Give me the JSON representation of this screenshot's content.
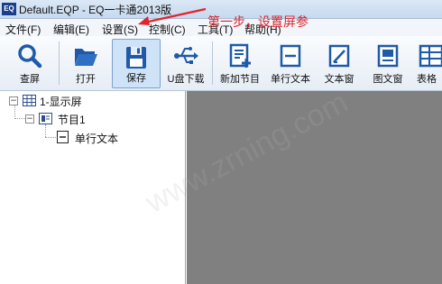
{
  "window": {
    "app_icon_text": "EQ",
    "title": "Default.EQP - EQ一卡通2013版"
  },
  "menu": [
    {
      "label": "文件(F)"
    },
    {
      "label": "编辑(E)"
    },
    {
      "label": "设置(S)"
    },
    {
      "label": "控制(C)"
    },
    {
      "label": "工具(T)"
    },
    {
      "label": "帮助(H)"
    }
  ],
  "toolbar": [
    {
      "label": "查屏",
      "icon": "magnifier-icon"
    },
    {
      "label": "打开",
      "icon": "folder-open-icon"
    },
    {
      "label": "保存",
      "icon": "save-disk-icon"
    },
    {
      "label": "U盘下载",
      "icon": "usb-icon"
    },
    {
      "label": "新加节目",
      "icon": "new-program-icon"
    },
    {
      "label": "单行文本",
      "icon": "single-line-text-icon"
    },
    {
      "label": "文本窗",
      "icon": "text-window-icon"
    },
    {
      "label": "图文窗",
      "icon": "image-text-window-icon"
    },
    {
      "label": "表格",
      "icon": "table-icon"
    }
  ],
  "tree": {
    "screen": {
      "label": "1-显示屏",
      "expander": "−"
    },
    "program": {
      "label": "节目1",
      "expander": "−"
    },
    "item": {
      "label": "单行文本"
    }
  },
  "annotation": {
    "text": "第一步，设置屏参"
  },
  "watermark": {
    "text": "www.zrning.com"
  },
  "colors": {
    "annotation": "#e0242c",
    "canvas": "#808080",
    "icon_blue": "#1f5aa8"
  }
}
